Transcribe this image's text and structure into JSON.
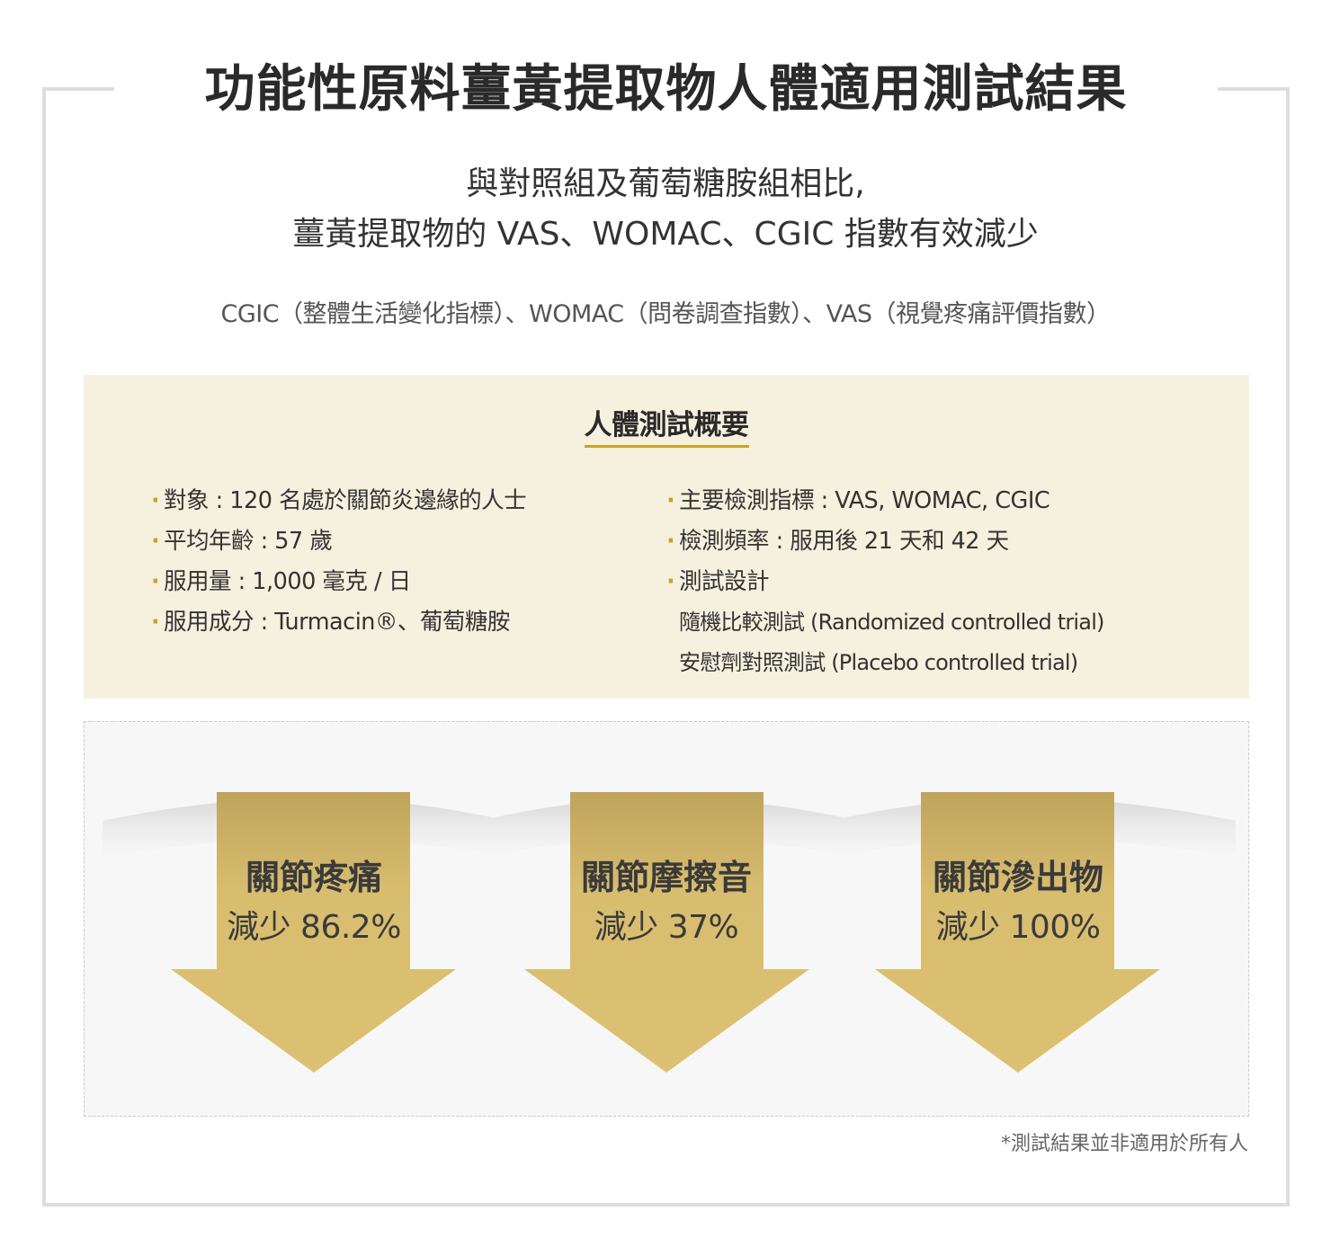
{
  "title": "功能性原料薑黃提取物人體適用測試結果",
  "subtitle": {
    "line1": "與對照組及葡萄糖胺組相比,",
    "line2": "薑黃提取物的 VAS、WOMAC、CGIC 指數有效減少"
  },
  "legend": "CGIC（整體生活變化指標）、WOMAC（問卷調查指數）、VAS（視覺疼痛評價指數）",
  "summary": {
    "heading": "人體測試概要",
    "bullet": "·",
    "left_items": [
      "對象 : 120 名處於關節炎邊緣的人士",
      "平均年齡 : 57 歲",
      "服用量 : 1,000 毫克 / 日",
      "服用成分 : Turmacin®、葡萄糖胺"
    ],
    "right_items": [
      "主要檢測指標 : VAS, WOMAC, CGIC",
      "檢測頻率 : 服用後 21 天和 42 天",
      "測試設計"
    ],
    "design_items": [
      "隨機比較測試 (Randomized controlled trial)",
      "安慰劑對照測試 (Placebo controlled trial)"
    ]
  },
  "results": [
    {
      "label": "關節疼痛",
      "value": "減少 86.2%"
    },
    {
      "label": "關節摩擦音",
      "value": "減少 37%"
    },
    {
      "label": "關節滲出物",
      "value": "減少 100%"
    }
  ],
  "colors": {
    "arrow": "#dcc173",
    "accent": "#c9a227",
    "summary_bg": "#f6f1de"
  },
  "note": "*測試結果並非適用於所有人"
}
